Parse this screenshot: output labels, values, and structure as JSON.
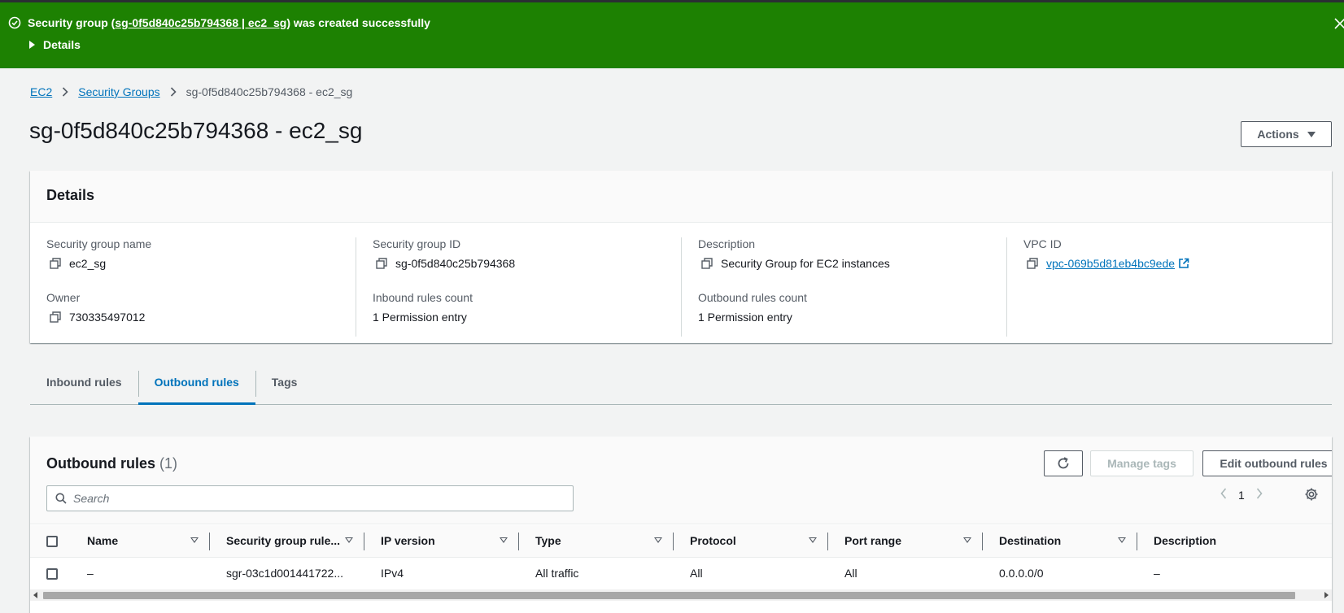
{
  "banner": {
    "prefix": "Security group (",
    "link": "sg-0f5d840c25b794368 | ec2_sg",
    "suffix": ") was created successfully",
    "details_label": "Details"
  },
  "breadcrumb": {
    "items": [
      "EC2",
      "Security Groups"
    ],
    "current": "sg-0f5d840c25b794368 - ec2_sg"
  },
  "page": {
    "title": "sg-0f5d840c25b794368 - ec2_sg",
    "actions_label": "Actions"
  },
  "details": {
    "header": "Details",
    "sg_name_label": "Security group name",
    "sg_name": "ec2_sg",
    "sg_id_label": "Security group ID",
    "sg_id": "sg-0f5d840c25b794368",
    "description_label": "Description",
    "description": "Security Group for EC2 instances",
    "vpc_label": "VPC ID",
    "vpc_id": "vpc-069b5d81eb4bc9ede",
    "owner_label": "Owner",
    "owner": "730335497012",
    "inbound_count_label": "Inbound rules count",
    "inbound_count": "1 Permission entry",
    "outbound_count_label": "Outbound rules count",
    "outbound_count": "1 Permission entry"
  },
  "tabs": [
    "Inbound rules",
    "Outbound rules",
    "Tags"
  ],
  "active_tab": "Outbound rules",
  "rules": {
    "title": "Outbound rules",
    "count": "(1)",
    "manage_tags_label": "Manage tags",
    "edit_label": "Edit outbound rules",
    "search_placeholder": "Search",
    "page": "1",
    "columns": [
      "Name",
      "Security group rule...",
      "IP version",
      "Type",
      "Protocol",
      "Port range",
      "Destination",
      "Description"
    ],
    "rows": [
      [
        "–",
        "sgr-03c1d001441722...",
        "IPv4",
        "All traffic",
        "All",
        "All",
        "0.0.0.0/0",
        "–"
      ]
    ]
  },
  "colors": {
    "success_green": "#1d8102",
    "link_blue": "#0073bb",
    "text": "#16191f"
  }
}
